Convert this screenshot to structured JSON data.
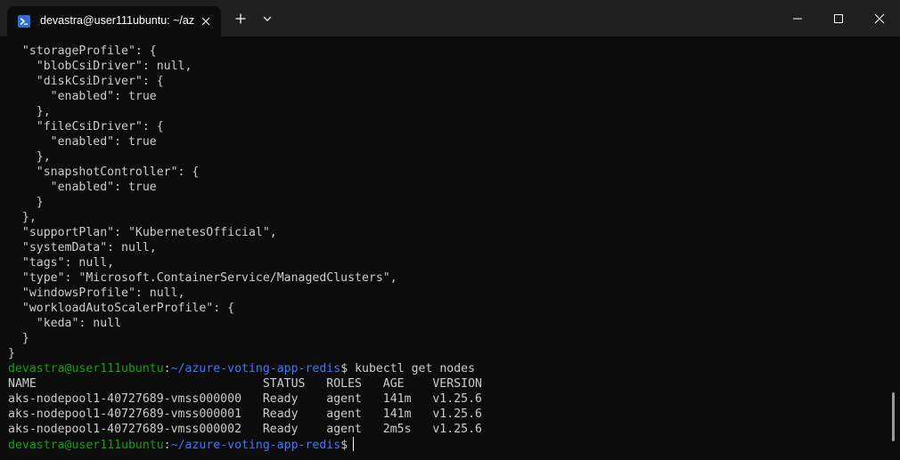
{
  "window": {
    "tab_title": "devastra@user111ubuntu: ~/az",
    "tab_icon": "powershell-icon",
    "new_tab_icon": "plus-icon",
    "dropdown_icon": "chevron-down-icon",
    "minimize_icon": "minimize-icon",
    "maximize_icon": "maximize-icon",
    "close_icon": "close-icon"
  },
  "colors": {
    "background": "#0c0c0c",
    "titlebar": "#202020",
    "text": "#cccccc",
    "prompt_user": "#13a10e",
    "prompt_path": "#3b78ff"
  },
  "terminal": {
    "json_lines": [
      "  \"storageProfile\": {",
      "    \"blobCsiDriver\": null,",
      "    \"diskCsiDriver\": {",
      "      \"enabled\": true",
      "    },",
      "    \"fileCsiDriver\": {",
      "      \"enabled\": true",
      "    },",
      "    \"snapshotController\": {",
      "      \"enabled\": true",
      "    }",
      "  },",
      "  \"supportPlan\": \"KubernetesOfficial\",",
      "  \"systemData\": null,",
      "  \"tags\": null,",
      "  \"type\": \"Microsoft.ContainerService/ManagedClusters\",",
      "  \"windowsProfile\": null,",
      "  \"workloadAutoScalerProfile\": {",
      "    \"keda\": null",
      "  }",
      "}"
    ],
    "prompt": {
      "user_host": "devastra@user111ubuntu",
      "separator": ":",
      "path": "~/azure-voting-app-redis",
      "symbol": "$ "
    },
    "command": "kubectl get nodes",
    "output_lines": [
      "NAME                                STATUS   ROLES   AGE    VERSION",
      "aks-nodepool1-40727689-vmss000000   Ready    agent   141m   v1.25.6",
      "aks-nodepool1-40727689-vmss000001   Ready    agent   141m   v1.25.6",
      "aks-nodepool1-40727689-vmss000002   Ready    agent   2m5s   v1.25.6"
    ]
  }
}
